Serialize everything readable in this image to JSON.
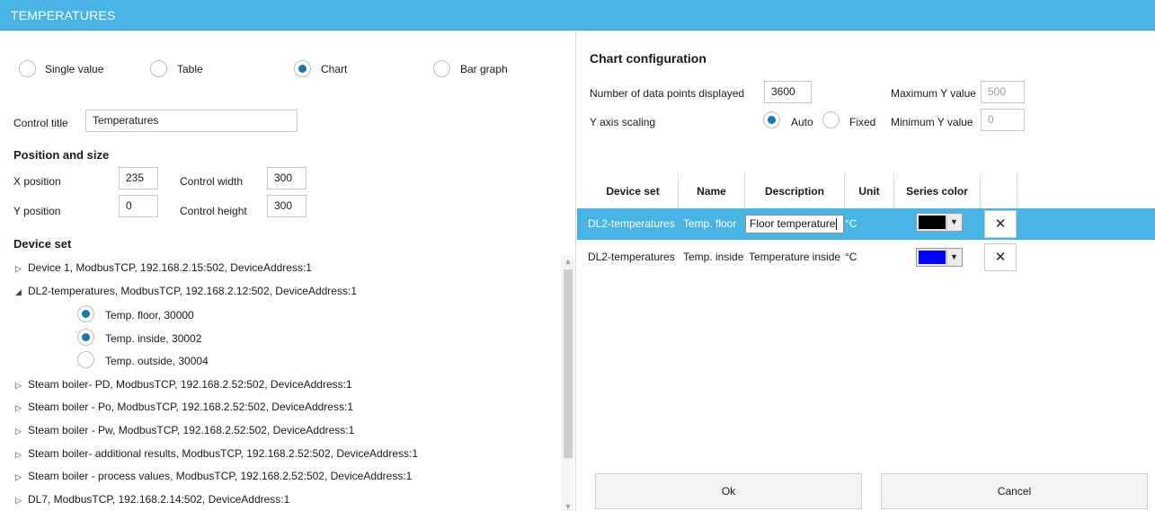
{
  "window": {
    "title": "TEMPERATURES"
  },
  "control_type": {
    "options": [
      "Single value",
      "Table",
      "Chart",
      "Bar graph"
    ],
    "selected": "Chart"
  },
  "control_title": {
    "label": "Control title",
    "value": "Temperatures"
  },
  "position_size": {
    "heading": "Position and size",
    "x_label": "X position",
    "x_value": "235",
    "y_label": "Y position",
    "y_value": "0",
    "width_label": "Control width",
    "width_value": "300",
    "height_label": "Control height",
    "height_value": "300"
  },
  "device_set": {
    "heading": "Device set",
    "items": [
      {
        "label": "Device 1, ModbusTCP, 192.168.2.15:502, DeviceAddress:1",
        "expanded": false
      },
      {
        "label": "DL2-temperatures, ModbusTCP, 192.168.2.12:502, DeviceAddress:1",
        "expanded": true,
        "children": [
          {
            "label": "Temp. floor, 30000",
            "checked": true
          },
          {
            "label": "Temp. inside, 30002",
            "checked": true
          },
          {
            "label": "Temp. outside, 30004",
            "checked": false
          }
        ]
      },
      {
        "label": "Steam boiler- PD, ModbusTCP, 192.168.2.52:502, DeviceAddress:1",
        "expanded": false
      },
      {
        "label": "Steam boiler - Po, ModbusTCP, 192.168.2.52:502, DeviceAddress:1",
        "expanded": false
      },
      {
        "label": "Steam boiler - Pw, ModbusTCP, 192.168.2.52:502, DeviceAddress:1",
        "expanded": false
      },
      {
        "label": "Steam boiler- additional results, ModbusTCP, 192.168.2.52:502, DeviceAddress:1",
        "expanded": false
      },
      {
        "label": "Steam boiler - process values, ModbusTCP, 192.168.2.52:502, DeviceAddress:1",
        "expanded": false
      },
      {
        "label": "DL7, ModbusTCP, 192.168.2.14:502, DeviceAddress:1",
        "expanded": false
      }
    ]
  },
  "chart_config": {
    "heading": "Chart configuration",
    "points_label": "Number of  data points displayed",
    "points_value": "3600",
    "max_y_label": "Maximum Y value",
    "max_y_value": "500",
    "min_y_label": "Minimum Y value",
    "min_y_value": "0",
    "scaling_label": "Y axis scaling",
    "scaling_auto": "Auto",
    "scaling_fixed": "Fixed",
    "scaling_selected": "Auto"
  },
  "series_table": {
    "headers": [
      "Device set",
      "Name",
      "Description",
      "Unit",
      "Series color"
    ],
    "rows": [
      {
        "device_set": "DL2-temperatures",
        "name": "Temp. floor",
        "description": "Floor temperature",
        "unit": "°C",
        "color": "#000000",
        "selected": true
      },
      {
        "device_set": "DL2-temperatures",
        "name": "Temp. inside",
        "description": "Temperature inside",
        "unit": "°C",
        "color": "#0000ff",
        "selected": false
      }
    ],
    "delete_glyph": "✕"
  },
  "buttons": {
    "ok": "Ok",
    "cancel": "Cancel"
  },
  "icons": {
    "expanded": "◢",
    "collapsed": "▷",
    "scroll_up": "▲",
    "scroll_down": "▼",
    "dropdown": "▼"
  }
}
